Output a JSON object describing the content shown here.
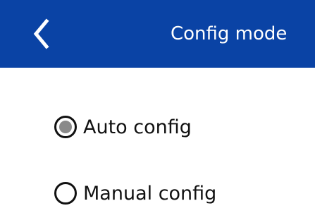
{
  "header": {
    "title": "Config mode",
    "back_icon": "chevron-left-icon",
    "background_color": "#0a43a5"
  },
  "options": [
    {
      "label": "Auto config",
      "selected": true
    },
    {
      "label": "Manual config",
      "selected": false
    }
  ],
  "colors": {
    "radio_selected_fill": "#8a8a8a",
    "radio_stroke": "#111111"
  }
}
